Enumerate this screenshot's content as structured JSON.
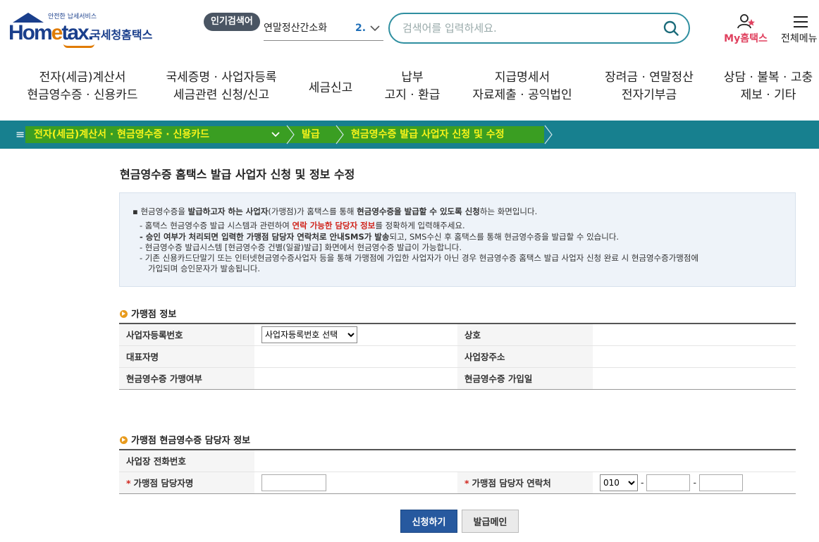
{
  "header": {
    "logo_tag": "안전한 납세서비스",
    "logo_main": "Hom",
    "logo_main_tail": "tax.",
    "logo_kr": "국세청홈택스",
    "popular_badge": "인기검색어",
    "popular_term": "연말정산간소화",
    "popular_rank": "2.",
    "search_placeholder": "검색어를 입력하세요.",
    "my_hometax": "My홈택스",
    "all_menu": "전체메뉴"
  },
  "nav": {
    "items": [
      {
        "line1": "전자(세금)계산서",
        "line2": "현금영수증 · 신용카드"
      },
      {
        "line1": "국세증명 · 사업자등록",
        "line2": "세금관련 신청/신고"
      },
      {
        "line1": "세금신고",
        "line2": ""
      },
      {
        "line1": "납부",
        "line2": "고지 · 환급"
      },
      {
        "line1": "지급명세서",
        "line2": "자료제출 · 공익법인"
      },
      {
        "line1": "장려금 · 연말정산",
        "line2": "전자기부금"
      },
      {
        "line1": "상담 · 불복 · 고충",
        "line2": "제보 · 기타"
      }
    ]
  },
  "breadcrumb": {
    "items": [
      "전자(세금)계산서 · 현금영수증 · 신용카드",
      "발급",
      "현금영수증 발급 사업자 신청 및 수정"
    ]
  },
  "page": {
    "title": "현금영수증 홈택스 발급 사업자 신청 및 정보 수정",
    "notice": {
      "lead": {
        "p1": "▪ 현금영수증을 ",
        "b1": "발급하고자 하는 사업자",
        "p2": "(가맹점)가 홈택스를 통해 ",
        "b2": "현금영수증을 발급할 수 있도록 신청",
        "p3": "하는 화면입니다."
      },
      "line1": {
        "p1": "- 홈택스 현금영수증 발급 시스템과 관련하여 ",
        "red": "연락 가능한 담당자 정보",
        "p2": "를 정확하게 입력해주세요."
      },
      "line2": {
        "b1": "- 승인 여부가 처리되면 입력한 가맹점 담당자 연락처로 안내SMS가 발송",
        "p2": "되고, SMS수신 후 홈택스를 통해 현금영수증을 발급할 수 있습니다."
      },
      "line3": "- 현금영수증 발급시스템 [현금영수증 건별(일괄)발급] 화면에서 현금영수증 발급이 가능합니다.",
      "line4": "- 기존 신용카드단말기 또는 인터넷현금영수증사업자 등을 통해 가맹점에 가입한 사업자가 아닌 경우 현금영수증 홈택스 발급 사업자 신청 완료 시 현금영수증가맹점에",
      "line5": "가입되며 승인문자가 발송됩니다."
    },
    "merchant_section": {
      "title": "가맹점 정보",
      "biz_no_label": "사업자등록번호",
      "biz_no_select": "사업자등록번호 선택",
      "company_label": "상호",
      "ceo_label": "대표자명",
      "address_label": "사업장주소",
      "member_label": "현금영수증 가맹여부",
      "join_date_label": "현금영수증 가입일"
    },
    "contact_section": {
      "title": "가맹점 현금영수증 담당자 정보",
      "phone_label": "사업장 전화번호",
      "manager_name_label": "가맹점 담당자명",
      "manager_phone_label": "가맹점 담당자 연락처",
      "req_mark": "*",
      "phone_prefix": "010",
      "dash": "-"
    },
    "buttons": {
      "apply": "신청하기",
      "issue_main": "발급메인"
    }
  },
  "colors": {
    "brand_blue": "#1a3f8c",
    "breadcrumb_bg": "#17808f",
    "highlight_yellow": "#f6f31a",
    "primary_button": "#27599f"
  }
}
